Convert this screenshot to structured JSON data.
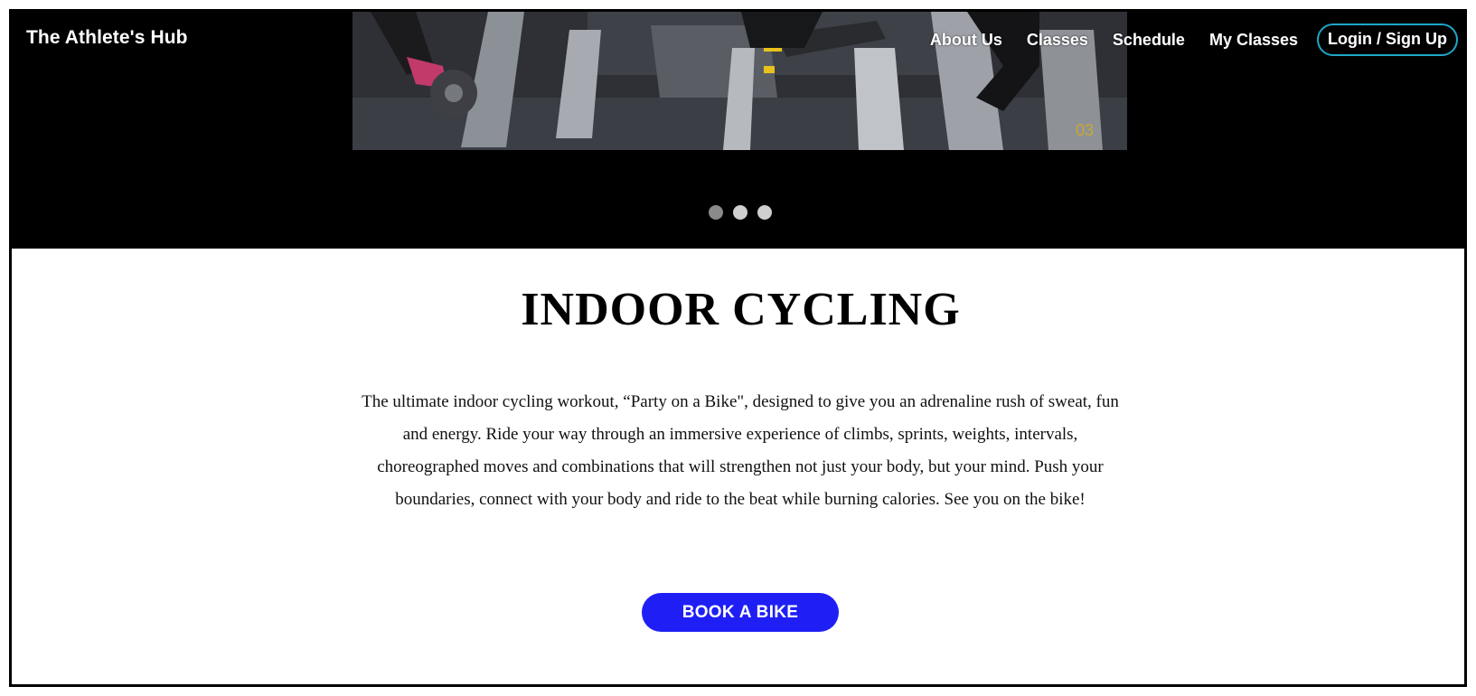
{
  "header": {
    "brand": "The Athlete's Hub",
    "nav": [
      {
        "label": "About Us"
      },
      {
        "label": "Classes"
      },
      {
        "label": "Schedule"
      },
      {
        "label": "My Classes"
      }
    ],
    "login_label": "Login / Sign Up"
  },
  "hero": {
    "image_icon": "indoor-cycling-photo",
    "bike_number": "03",
    "slides": 3,
    "active_slide": 1
  },
  "main": {
    "title": "INDOOR CYCLING",
    "description": "The ultimate indoor cycling workout, “Party on a Bike\", designed to give you an adrenaline rush of sweat, fun and energy. Ride your way through an immersive experience of climbs, sprints, weights, intervals, choreographed moves and combinations that will strengthen not just your body, but your mind. Push your boundaries, connect with your body and ride to the beat while burning calories. See you on the bike!",
    "cta_label": "BOOK A BIKE"
  },
  "colors": {
    "hero_bg": "#000000",
    "accent_border": "#1fa6c9",
    "cta_bg": "#1f1ff5"
  }
}
